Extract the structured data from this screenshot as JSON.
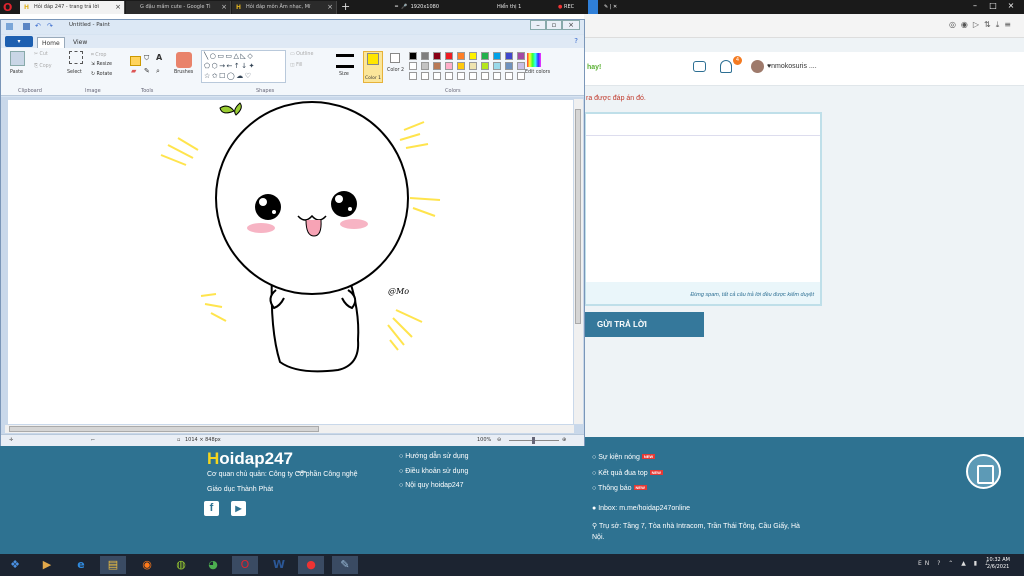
{
  "browser": {
    "tabs": [
      {
        "label": "Hỏi đáp 247 - trang trả lời"
      },
      {
        "label": "G đậu mầm cute - Google Tì"
      },
      {
        "label": "Hỏi đáp môn Âm nhạc, Mĩ"
      }
    ],
    "new_tab": "+",
    "recorder": {
      "resolution": "1920x1080",
      "display": "Hiển thị 1",
      "rec": "REC"
    },
    "window_controls": [
      "–",
      "□",
      "×"
    ]
  },
  "site": {
    "header_partial": "hay!",
    "notification_count": "4",
    "username": "♥nmokosuris ....",
    "notice": "ra được đáp án đó.",
    "editor_warning": "Đừng spam, tất cả câu trả lời đều được kiểm duyệt",
    "submit_label": "GỬI TRẢ LỜI"
  },
  "footer": {
    "logo_first": "H",
    "logo_rest": "oidap247",
    "logo_com": ".com",
    "company": "Cơ quan chủ quản: Công ty Cổ phần Công nghệ",
    "company2": "Giáo dục Thành Phát",
    "links_col1": [
      "Hướng dẫn sử dụng",
      "Điều khoản sử dụng",
      "Nội quy hoidap247"
    ],
    "links_col2": [
      "Sự kiện nóng",
      "Kết quả đua top",
      "Thông báo"
    ],
    "new_badge": "NEW",
    "social": {
      "facebook": "f",
      "youtube": "▶"
    },
    "inbox": "Inbox: m.me/hoidap247online",
    "address": "Trụ sở: Tầng 7, Tòa nhà Intracom, Trần Thái Tông, Cầu Giấy, Hà",
    "address2": "Nội."
  },
  "paint": {
    "title": "Untitled - Paint",
    "file_tab": "▾",
    "tabs": [
      "Home",
      "View"
    ],
    "clipboard": {
      "paste": "Paste",
      "cut": "Cut",
      "copy": "Copy",
      "group": "Clipboard"
    },
    "image": {
      "select": "Select",
      "crop": "Crop",
      "resize": "Resize",
      "rotate": "Rotate",
      "group": "Image"
    },
    "tools": {
      "group": "Tools"
    },
    "brushes": "Brushes",
    "shapes": {
      "outline": "Outline",
      "fill": "Fill",
      "group": "Shapes"
    },
    "size": "Size",
    "color1": "Color 1",
    "color2": "Color 2",
    "colors_group": "Colors",
    "edit_colors": "Edit colors",
    "palette": [
      "#000000",
      "#7f7f7f",
      "#880015",
      "#ed1c24",
      "#ff7f27",
      "#fff200",
      "#22b14c",
      "#00a2e8",
      "#3f48cc",
      "#a349a4",
      "#ffffff",
      "#c3c3c3",
      "#b97a57",
      "#ffaec9",
      "#ffc90e",
      "#efe4b0",
      "#b5e61d",
      "#99d9ea",
      "#7092be",
      "#c8bfe7"
    ],
    "signature": "@Mo",
    "status_size": "1014 × 848px",
    "zoom": "100%"
  },
  "taskbar": {
    "time": "10:32 AM",
    "date": "2/6/2021",
    "lang": "EN"
  }
}
